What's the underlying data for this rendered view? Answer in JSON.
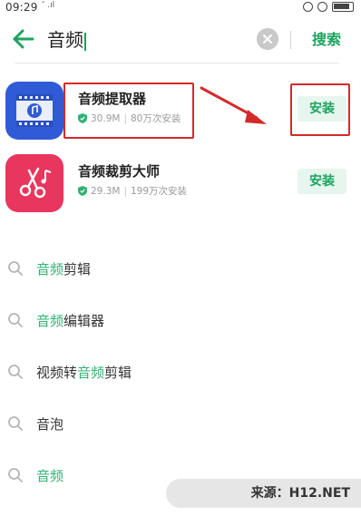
{
  "status_bar": {
    "time": "09:29",
    "signal": "″ .ıl"
  },
  "search": {
    "query": "音频",
    "search_label": "搜索"
  },
  "apps": [
    {
      "name": "音频提取器",
      "size": "30.9M",
      "installs": "80万次安装",
      "install_label": "安装",
      "icon_color": "#2f5bd6"
    },
    {
      "name": "音频裁剪大师",
      "size": "29.3M",
      "installs": "199万次安装",
      "install_label": "安装",
      "icon_color": "#e8365e"
    }
  ],
  "suggestions": [
    {
      "before": "",
      "highlight": "音频",
      "after": "剪辑"
    },
    {
      "before": "",
      "highlight": "音频",
      "after": "编辑器"
    },
    {
      "before": "视频转",
      "highlight": "音频",
      "after": "剪辑"
    },
    {
      "before": "音泡",
      "highlight": "",
      "after": ""
    },
    {
      "before": "",
      "highlight": "音频",
      "after": ""
    }
  ],
  "watermark": "来源：H12.NET",
  "colors": {
    "accent_green": "#1ea35f",
    "highlight_red": "#d42a2a"
  }
}
